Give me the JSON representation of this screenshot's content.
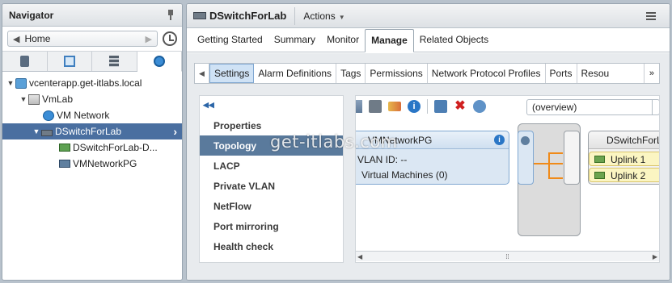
{
  "navigator": {
    "title": "Navigator",
    "home_label": "Home",
    "tabs": [
      {
        "icon": "hosts-clusters-icon"
      },
      {
        "icon": "vms-templates-icon"
      },
      {
        "icon": "storage-icon"
      },
      {
        "icon": "networking-icon"
      }
    ],
    "tree": [
      {
        "label": "vcenterapp.get-itlabs.local",
        "icon": "vcenter-icon"
      },
      {
        "label": "VmLab",
        "icon": "datacenter-icon"
      },
      {
        "label": "VM Network",
        "icon": "network-icon"
      },
      {
        "label": "DSwitchForLab",
        "icon": "distributed-switch-icon"
      },
      {
        "label": "DSwitchForLab-D...",
        "icon": "port-group-icon"
      },
      {
        "label": "VMNetworkPG",
        "icon": "port-group-icon"
      }
    ]
  },
  "main": {
    "title": "DSwitchForLab",
    "actions_label": "Actions",
    "tabs": [
      "Getting Started",
      "Summary",
      "Monitor",
      "Manage",
      "Related Objects"
    ],
    "subtabs": [
      "Settings",
      "Alarm Definitions",
      "Tags",
      "Permissions",
      "Network Protocol Profiles",
      "Ports",
      "Resou"
    ],
    "settings_items": [
      "Properties",
      "Topology",
      "LACP",
      "Private VLAN",
      "NetFlow",
      "Port mirroring",
      "Health check"
    ],
    "view_select": "(overview)",
    "topology": {
      "portgroup_name": "VMNetworkPG",
      "vlan_line": "VLAN ID: --",
      "vm_line": "Virtual Machines (0)",
      "switch_name": "DSwitchForLab",
      "uplinks": [
        "Uplink 1",
        "Uplink 2"
      ]
    }
  },
  "watermark": "get-itlabs.com"
}
